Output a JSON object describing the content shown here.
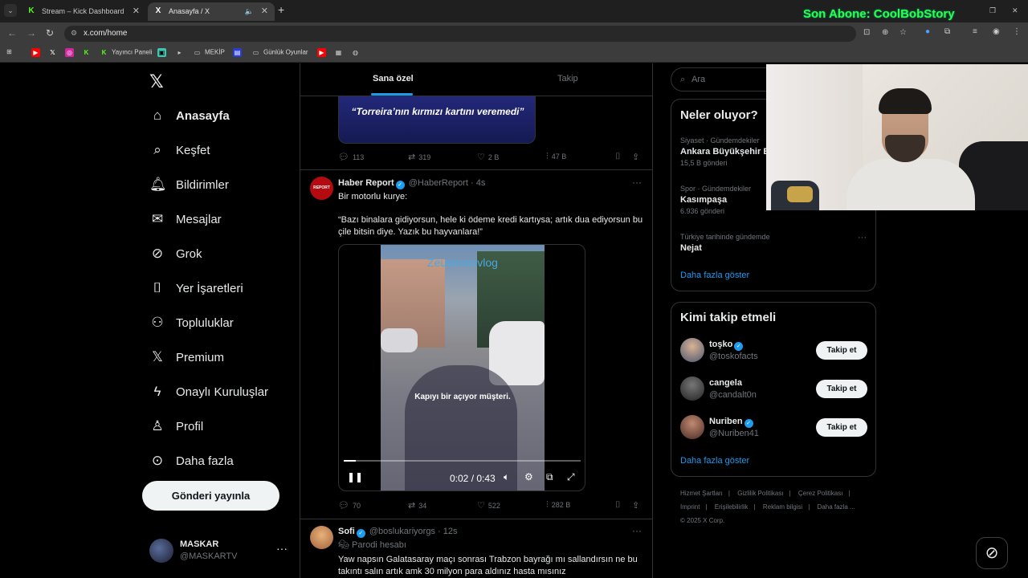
{
  "browser": {
    "tabs": [
      {
        "title": "Stream – Kick Dashboard",
        "favicon": "K"
      },
      {
        "title": "Anasayfa / X",
        "favicon": "X"
      }
    ],
    "url": "x.com/home",
    "bookmarks": [
      "Yayıncı Paneli",
      "MEKİP",
      "Günlük Oyunlar"
    ],
    "stream_overlay": "Son Abone: CoolBobStory"
  },
  "nav": {
    "items": [
      {
        "label": "Anasayfa",
        "icon": "home-icon"
      },
      {
        "label": "Keşfet",
        "icon": "search-icon"
      },
      {
        "label": "Bildirimler",
        "icon": "bell-icon"
      },
      {
        "label": "Mesajlar",
        "icon": "mail-icon"
      },
      {
        "label": "Grok",
        "icon": "grok-icon"
      },
      {
        "label": "Yer İşaretleri",
        "icon": "bookmark-icon"
      },
      {
        "label": "Topluluklar",
        "icon": "communities-icon"
      },
      {
        "label": "Premium",
        "icon": "x-icon"
      },
      {
        "label": "Onaylı Kuruluşlar",
        "icon": "lightning-icon"
      },
      {
        "label": "Profil",
        "icon": "person-icon"
      },
      {
        "label": "Daha fazla",
        "icon": "more-circle-icon"
      }
    ],
    "post_button": "Gönderi yayınla",
    "account": {
      "name": "MASKAR",
      "handle": "@MASKARTV"
    }
  },
  "timeline": {
    "tabs": [
      "Sana özel",
      "Takip"
    ],
    "top_card_quote": "“Torreira’nın kırmızı kartını veremedi”",
    "top_actions": {
      "replies": "113",
      "reposts": "319",
      "likes": "2 B",
      "views": "47 B"
    },
    "tweet1": {
      "name": "Haber Report",
      "handle": "@HaberReport",
      "time": "4s",
      "avatar_text": "REPORT",
      "line1": "Bir motorlu kurye:",
      "line2": "“Bazı binalara gidiyorsun, hele ki ödeme kredi kartıysa; artık dua ediyorsun bu çile bitsin diye. Yazık bu hayvanlara!”",
      "video": {
        "watermark": "Zeusmotovlog",
        "subtitle": "Kapıyı bir açıyor müşteri.",
        "time": "0:02 / 0:43",
        "progress": 0.05
      },
      "actions": {
        "replies": "70",
        "reposts": "34",
        "likes": "522",
        "views": "282 B"
      }
    },
    "tweet2": {
      "name": "Sofi",
      "handle": "@boslukariyorgs",
      "time": "12s",
      "label": "Parodi hesabı",
      "text": "Yaw napsın Galatasaray maçı sonrası Trabzon bayrağı mı sallandırsın ne bu takıntı salın artık amk 30 milyon para aldınız hasta mısınız"
    }
  },
  "right": {
    "search_placeholder": "Ara",
    "trends_title": "Neler oluyor?",
    "trends": [
      {
        "context": "Siyaset · Gündemdekiler",
        "name": "Ankara Büyükşehir B",
        "count": "15,5 B gönderi"
      },
      {
        "context": "Spor · Gündemdekiler",
        "name": "Kasımpaşa",
        "count": "6.936 gönderi"
      },
      {
        "context": "Türkiye tarihinde gündemde",
        "name": "Nejat",
        "count": ""
      }
    ],
    "trends_more": "Daha fazla göster",
    "who_title": "Kimi takip etmeli",
    "who": [
      {
        "name": "toşko",
        "handle": "@toskofacts",
        "verified": true,
        "button": "Takip et"
      },
      {
        "name": "cangela",
        "handle": "@candalt0n",
        "verified": false,
        "button": "Takip et"
      },
      {
        "name": "Nuriben",
        "handle": "@Nuriben41",
        "verified": true,
        "button": "Takip et"
      }
    ],
    "who_more": "Daha fazla göster",
    "footer_links": [
      "Hizmet Şartları",
      "|",
      "Gizlilik Politikası",
      "|",
      "Çerez Politikası",
      "|",
      "Imprint",
      "|",
      "Erişilebilirlik",
      "|",
      "Reklam bilgisi",
      "|",
      "Daha fazla ..."
    ],
    "copyright": "© 2025 X Corp."
  }
}
